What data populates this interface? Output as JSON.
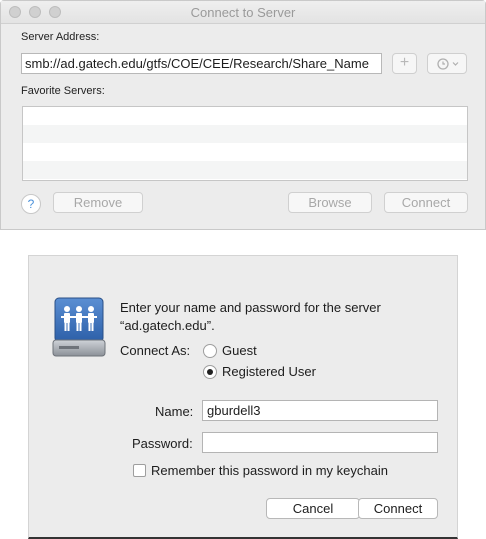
{
  "connect_window": {
    "title": "Connect to Server",
    "server_address_label": "Server Address:",
    "server_address_value": "smb://ad.gatech.edu/gtfs/COE/CEE/Research/Share_Name",
    "add_icon": "plus-icon",
    "history_icon": "clock-icon",
    "favorite_servers_label": "Favorite Servers:",
    "favorite_servers": [],
    "help_label": "?",
    "remove_label": "Remove",
    "browse_label": "Browse",
    "connect_label": "Connect"
  },
  "auth_dialog": {
    "icon": "shared-server-icon",
    "message_line1": "Enter your name and password for the server",
    "message_line2": "“ad.gatech.edu”.",
    "connect_as_label": "Connect As:",
    "options": [
      {
        "label": "Guest",
        "selected": false
      },
      {
        "label": "Registered User",
        "selected": true
      }
    ],
    "name_label": "Name:",
    "name_value": "gburdell3",
    "password_label": "Password:",
    "password_value": "",
    "remember_label": "Remember this password in my keychain",
    "remember_checked": false,
    "cancel_label": "Cancel",
    "connect_label": "Connect"
  }
}
